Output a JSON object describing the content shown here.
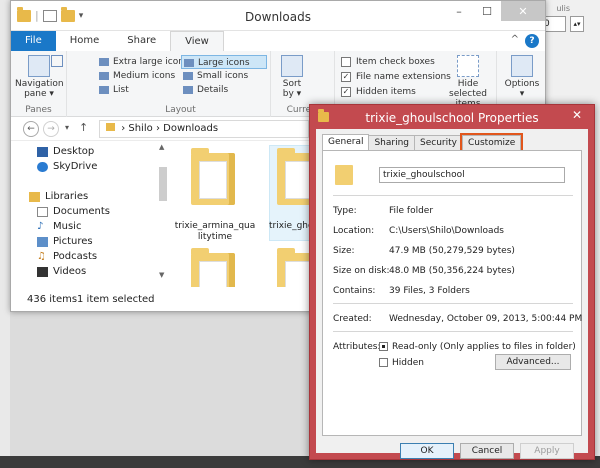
{
  "explorer": {
    "title": "Downloads",
    "window_buttons": {
      "minimize": "–",
      "maximize": "☐",
      "close": "✕"
    },
    "tabs": [
      "File",
      "Home",
      "Share",
      "View"
    ],
    "help": "?",
    "ribbon": {
      "panes": {
        "nav_label_1": "Navigation",
        "nav_label_2": "pane ▾",
        "group": "Panes"
      },
      "layout": {
        "items": [
          "Extra large icons",
          "Large icons",
          "Medium icons",
          "Small icons",
          "List",
          "Details"
        ],
        "group": "Layout"
      },
      "current_view": {
        "sort_1": "Sort",
        "sort_2": "by ▾",
        "group": "Current"
      },
      "show_hide": {
        "item_check_boxes": "Item check boxes",
        "file_name_extensions": "File name extensions",
        "hidden_items": "Hidden items",
        "hide_selected_1": "Hide selected",
        "hide_selected_2": "items"
      },
      "options": {
        "label_1": "Options",
        "label_2": "▾"
      }
    },
    "address": {
      "path_1": "Shilo",
      "sep": "›",
      "path_2": "Downloads"
    },
    "nav": {
      "back": "←",
      "forward": "→",
      "recent": "▾",
      "up": "↑",
      "items": [
        "Desktop",
        "SkyDrive",
        "Libraries",
        "Documents",
        "Music",
        "Pictures",
        "Podcasts",
        "Videos"
      ]
    },
    "files": [
      {
        "name": "trixie_armina_qua litytime"
      },
      {
        "name": "trixie_gho"
      }
    ],
    "status": {
      "count": "436 items",
      "selected": "1 item selected"
    }
  },
  "properties": {
    "title": "trixie_ghoulschool Properties",
    "close": "✕",
    "tabs": [
      "General",
      "Sharing",
      "Security",
      "Customize"
    ],
    "name": "trixie_ghoulschool",
    "rows": [
      {
        "label": "Type:",
        "value": "File folder"
      },
      {
        "label": "Location:",
        "value": "C:\\Users\\Shilo\\Downloads"
      },
      {
        "label": "Size:",
        "value": "47.9 MB (50,279,529 bytes)"
      },
      {
        "label": "Size on disk:",
        "value": "48.0 MB (50,356,224 bytes)"
      },
      {
        "label": "Contains:",
        "value": "39 Files, 3 Folders"
      },
      {
        "label": "Created:",
        "value": "Wednesday, October 09, 2013, 5:00:44 PM"
      }
    ],
    "attributes_label": "Attributes:",
    "readonly": "Read-only (Only applies to files in folder)",
    "hidden": "Hidden",
    "advanced": "Advanced...",
    "ok": "OK",
    "cancel": "Cancel",
    "apply": "Apply"
  },
  "background": {
    "field_value": "0",
    "small_label": "ulis"
  },
  "colors": {
    "accent": "#1a78c8",
    "dialog_frame": "#c34a4f",
    "tab_highlight": "#e1561c"
  }
}
